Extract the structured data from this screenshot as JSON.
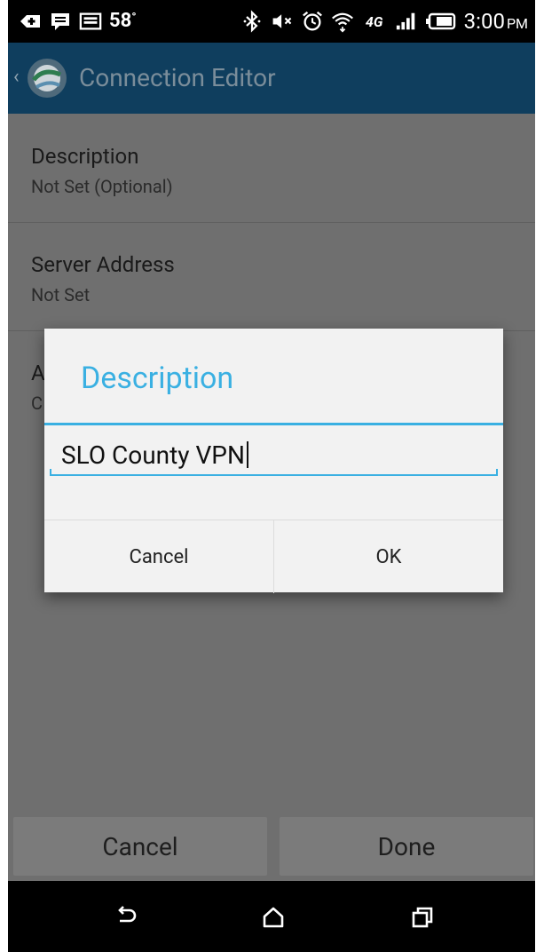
{
  "status_bar": {
    "temperature": "58",
    "degree": "°",
    "time": "3:00",
    "ampm": "PM",
    "icons": [
      "add-box-icon",
      "message-icon",
      "image-icon",
      "bluetooth-icon",
      "mute-icon",
      "alarm-icon",
      "wifi-icon",
      "4g-lte-icon",
      "signal-icon",
      "battery-icon"
    ],
    "network_label": "4G"
  },
  "app_bar": {
    "title": "Connection Editor",
    "back_glyph": "‹"
  },
  "settings": [
    {
      "title": "Description",
      "subtitle": "Not Set (Optional)"
    },
    {
      "title": "Server Address",
      "subtitle": "Not Set"
    }
  ],
  "partial_item": {
    "title_initial": "A",
    "subtitle_initial": "C"
  },
  "dialog": {
    "title": "Description",
    "input_value": "SLO County VPN",
    "cancel_label": "Cancel",
    "ok_label": "OK"
  },
  "bottom_bar": {
    "cancel_label": "Cancel",
    "done_label": "Done"
  },
  "nav_bar": {
    "icons": [
      "back-icon",
      "home-icon",
      "recents-icon"
    ]
  },
  "colors": {
    "accent": "#3ab0e2",
    "app_bar": "#0f3e5e",
    "scrim": "#6f6f6f"
  }
}
